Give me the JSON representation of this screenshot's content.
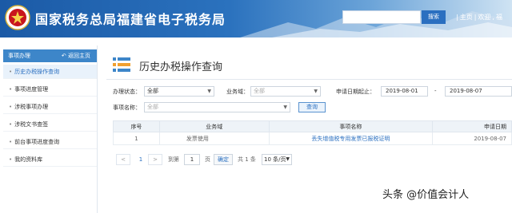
{
  "header": {
    "site_title": "国家税务总局福建省电子税务局",
    "search_placeholder": "",
    "search_button": "搜索",
    "links": [
      "主页",
      "欢迎",
      "福"
    ]
  },
  "sidebar": {
    "title": "事项办理",
    "back": "返回主页",
    "items": [
      {
        "label": "历史办税操作查询",
        "active": true
      },
      {
        "label": "事项进度管理"
      },
      {
        "label": "涉税事项办理"
      },
      {
        "label": "涉税文书查签"
      },
      {
        "label": "前台事项进度查询"
      },
      {
        "label": "我的资料库"
      }
    ]
  },
  "main": {
    "title": "历史办税操作查询",
    "filters": {
      "status_label": "办理状态：",
      "status_value": "全部",
      "business_label": "业务域：",
      "business_value": "全部",
      "date_label": "申请日期起止：",
      "date_from": "2019-08-01",
      "date_sep": "-",
      "date_to": "2019-08-07",
      "item_label": "事项名称：",
      "item_value": "全部",
      "query_button": "查询"
    },
    "table": {
      "headers": [
        "序号",
        "业务域",
        "事项名称",
        "申请日期"
      ],
      "rows": [
        [
          "1",
          "发票使用",
          "丢失增值税专用发票已报税证明",
          "2019-08-07"
        ]
      ]
    },
    "pager": {
      "prev": "<",
      "page": "1",
      "next": ">",
      "goto_label": "到第",
      "goto_value": "1",
      "page_unit": "页",
      "confirm": "确定",
      "total": "共 1 条",
      "page_size": "10 条/页"
    }
  },
  "watermark": "头条 @价值会计人"
}
